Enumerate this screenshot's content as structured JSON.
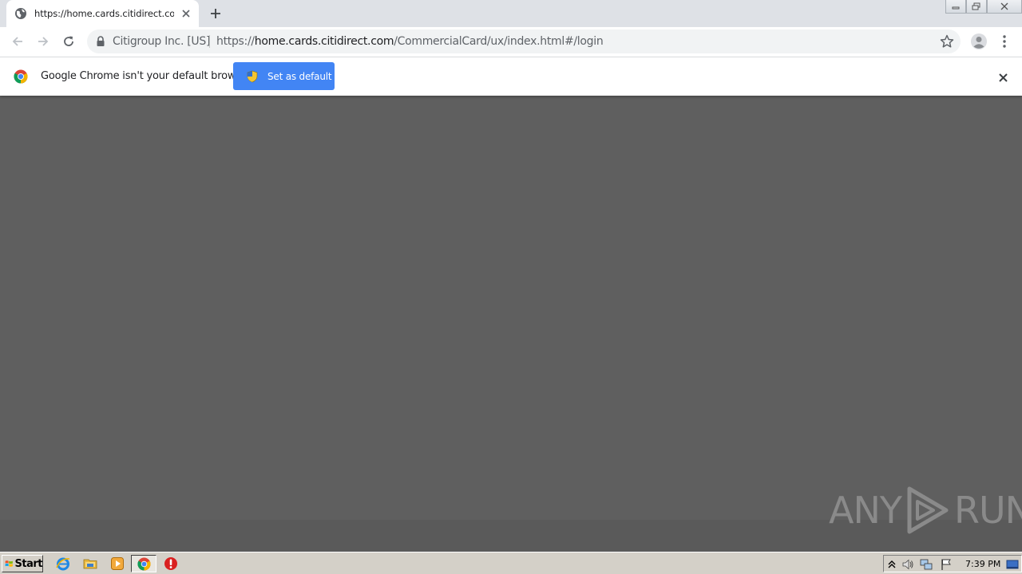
{
  "browser": {
    "tab": {
      "title": "https://home.cards.citidirect.com/CommercialCard/ux/index.html#/login"
    },
    "omnibox": {
      "org": "Citigroup Inc. [US]",
      "url_scheme": "https://",
      "url_host": "home.cards.citidirect.com",
      "url_path": "/CommercialCard/ux/index.html#/login"
    },
    "infobar": {
      "message": "Google Chrome isn't your default browser",
      "button_label": "Set as default"
    }
  },
  "watermark": {
    "left": "ANY",
    "right": "RUN"
  },
  "taskbar": {
    "start_label": "Start",
    "clock": "7:39 PM"
  },
  "colors": {
    "accent_blue": "#4285f4",
    "content_gray": "#5f5f5f",
    "tab_strip": "#dee1e6"
  },
  "icons": [
    "globe-icon",
    "close-icon",
    "plus-icon",
    "back-icon",
    "forward-icon",
    "reload-icon",
    "lock-icon",
    "star-icon",
    "profile-icon",
    "menu-icon",
    "chrome-icon",
    "shield-icon",
    "windows-flag-icon",
    "ie-icon",
    "folder-icon",
    "media-icon",
    "chrome-icon",
    "stop-icon",
    "tray-arrow-icon",
    "volume-icon",
    "network-icon",
    "flag-icon",
    "desktop-icon"
  ]
}
